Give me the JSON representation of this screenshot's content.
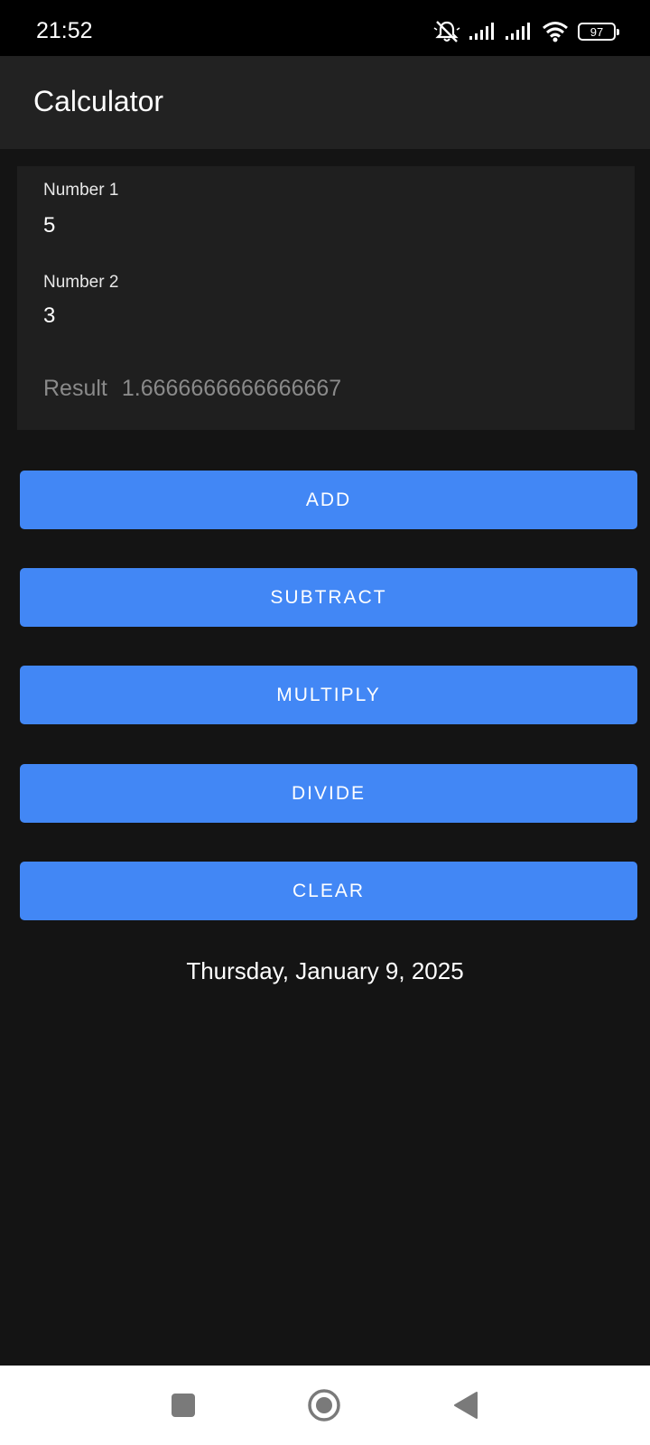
{
  "status_bar": {
    "time": "21:52",
    "battery_level": "97",
    "icons": [
      "bell-muted-icon",
      "signal-icon",
      "signal-icon",
      "wifi-icon",
      "battery-icon"
    ]
  },
  "app_bar": {
    "title": "Calculator"
  },
  "inputs": {
    "number1": {
      "label": "Number 1",
      "value": "5"
    },
    "number2": {
      "label": "Number 2",
      "value": "3"
    }
  },
  "result": {
    "label": "Result",
    "value": "1.6666666666666667"
  },
  "buttons": {
    "add": "ADD",
    "subtract": "SUBTRACT",
    "multiply": "MULTIPLY",
    "divide": "DIVIDE",
    "clear": "CLEAR"
  },
  "date": "Thursday, January 9, 2025",
  "nav_bar": {
    "icons": [
      "recents-icon",
      "home-icon",
      "back-icon"
    ]
  },
  "colors": {
    "background": "#141414",
    "app_bar": "#222222",
    "card": "#1f1f1f",
    "accent": "#4287f5",
    "result_text": "#8a8a8a"
  }
}
